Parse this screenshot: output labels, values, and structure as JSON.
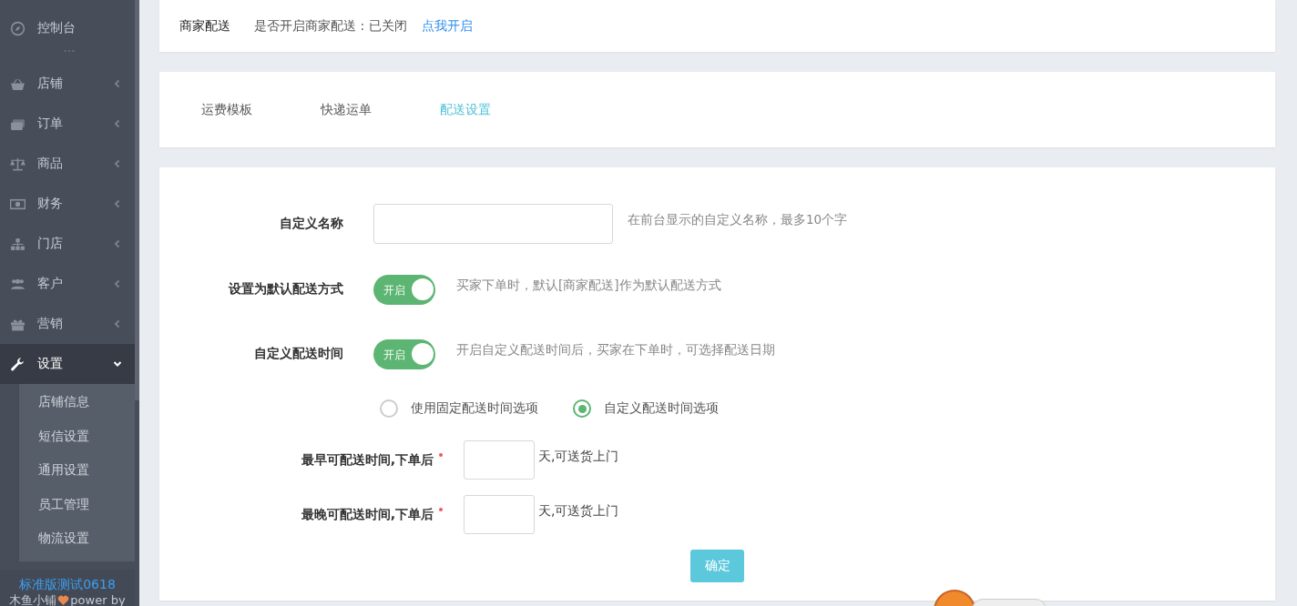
{
  "sidebar": {
    "top": {
      "label": "控制台"
    },
    "items": [
      {
        "label": "店铺",
        "expanded": false,
        "selected": false
      },
      {
        "label": "订单",
        "expanded": false,
        "selected": false
      },
      {
        "label": "商品",
        "expanded": false,
        "selected": false
      },
      {
        "label": "财务",
        "expanded": false,
        "selected": false
      },
      {
        "label": "门店",
        "expanded": false,
        "selected": false
      },
      {
        "label": "客户",
        "expanded": false,
        "selected": false
      },
      {
        "label": "营销",
        "expanded": false,
        "selected": false
      },
      {
        "label": "设置",
        "expanded": true,
        "selected": true,
        "children": [
          {
            "label": "店铺信息"
          },
          {
            "label": "短信设置"
          },
          {
            "label": "通用设置"
          },
          {
            "label": "员工管理"
          },
          {
            "label": "物流设置"
          }
        ]
      }
    ],
    "footer": {
      "version": "标准版测试0618",
      "shop": "木鱼小铺",
      "power": "power by"
    }
  },
  "status_card": {
    "title": "商家配送",
    "text": "是否开启商家配送 : 已关闭",
    "link": "点我开启"
  },
  "tabs": [
    {
      "label": "运费模板",
      "selected": false
    },
    {
      "label": "快递运单",
      "selected": false
    },
    {
      "label": "配送设置",
      "selected": true
    }
  ],
  "form": {
    "name_field": {
      "label": "自定义名称",
      "hint": "在前台显示的自定义名称，最多10个字"
    },
    "switches": [
      {
        "label": "设置为默认配送方式",
        "on": true,
        "text": "开启",
        "hint": "买家下单时，默认[商家配送]作为默认配送方式"
      },
      {
        "label": "自定义配送时间",
        "on": true,
        "text": "开启",
        "hint": "开启自定义配送时间后，买家在下单时，可选择配送日期"
      }
    ],
    "radios": [
      {
        "label": "使用固定配送时间选项",
        "selected": false
      },
      {
        "label": "自定义配送时间选项",
        "selected": true
      }
    ],
    "day_fields": [
      {
        "label": "最早可配送时间,下单后",
        "required": true,
        "unit": "天,可送货上门"
      },
      {
        "label": "最晚可配送时间,下单后",
        "required": true,
        "unit": "天,可送货上门"
      }
    ],
    "submit": "确定"
  }
}
